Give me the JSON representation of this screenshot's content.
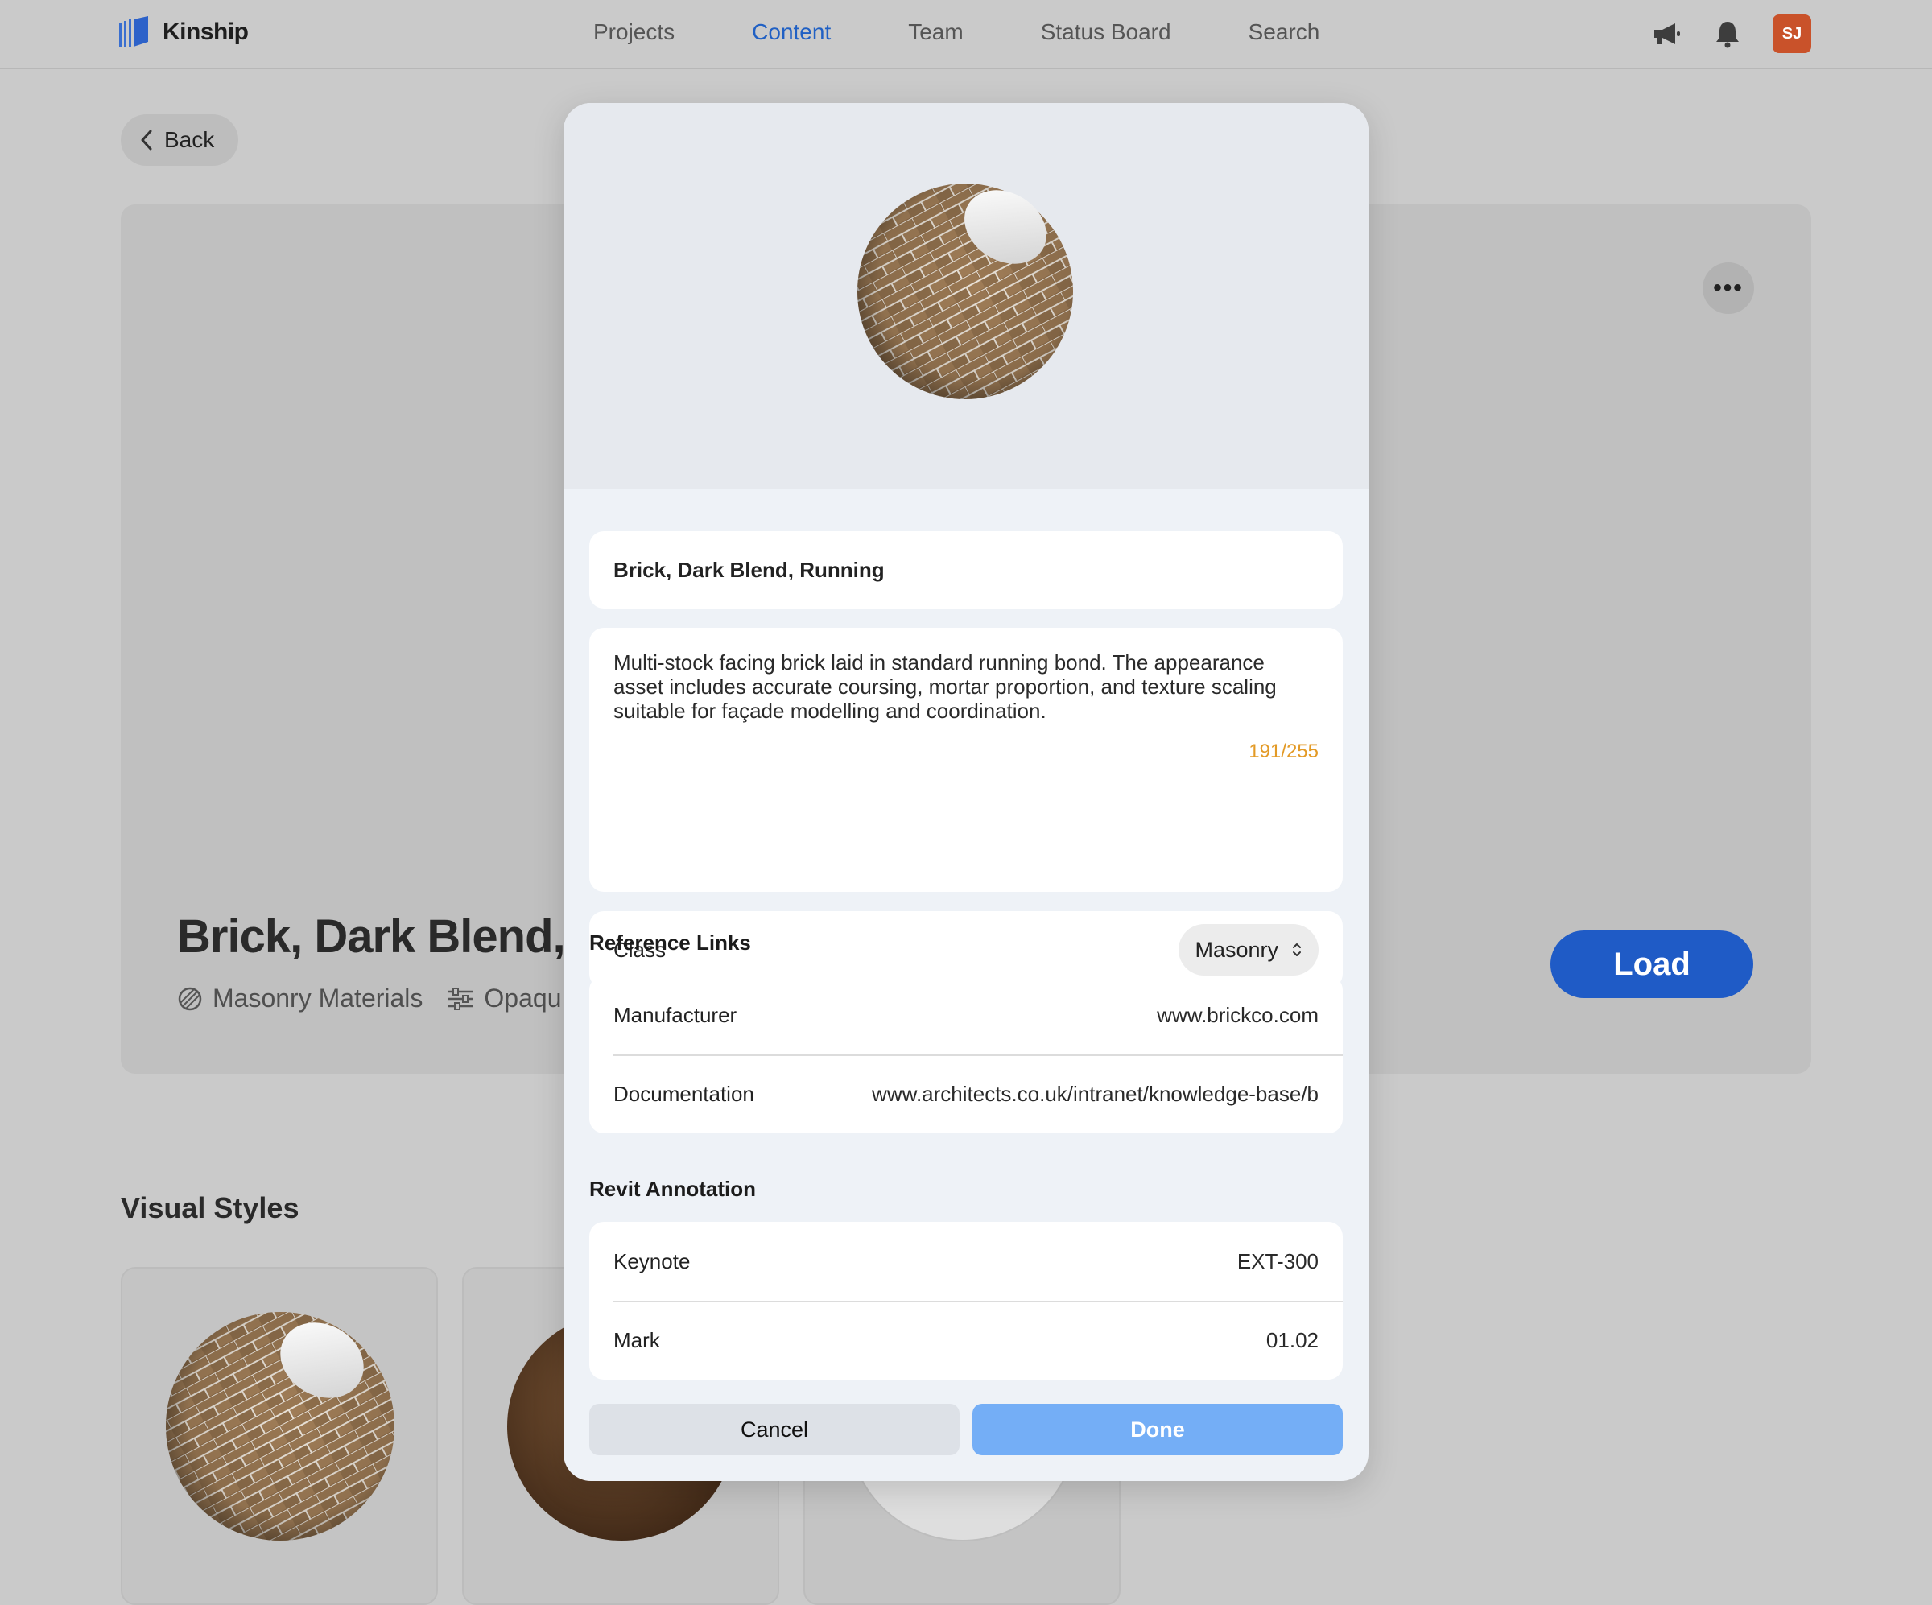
{
  "app": {
    "name": "Kinship",
    "nav": [
      {
        "label": "Projects",
        "active": false
      },
      {
        "label": "Content",
        "active": true
      },
      {
        "label": "Team",
        "active": false
      },
      {
        "label": "Status Board",
        "active": false
      },
      {
        "label": "Search",
        "active": false
      }
    ],
    "icons": [
      "megaphone-icon",
      "bell-icon"
    ],
    "avatar_initials": "SJ",
    "accent_color": "#2060c4",
    "avatar_color": "#c9522a"
  },
  "page": {
    "back_label": "Back",
    "title": "Brick, Dark Blend, R",
    "meta": [
      {
        "icon": "material-icon",
        "label": "Masonry Materials"
      },
      {
        "icon": "sliders-icon",
        "label": "Opaqu"
      }
    ],
    "more_label": "•••",
    "load_label": "Load",
    "load_color": "#1f5bc6",
    "section_title": "Visual Styles"
  },
  "modal": {
    "name": "Brick, Dark Blend, Running",
    "description": "Multi-stock facing brick laid in standard running bond. The appearance asset includes accurate coursing, mortar proportion, and texture scaling suitable for façade modelling and coordination.",
    "char_count": "191/255",
    "class_label": "Class",
    "class_value": "Masonry",
    "reference_links_title": "Reference Links",
    "reference_links": [
      {
        "label": "Manufacturer",
        "value": "www.brickco.com"
      },
      {
        "label": "Documentation",
        "value": "www.architects.co.uk/intranet/knowledge-base/b"
      }
    ],
    "revit_title": "Revit Annotation",
    "revit_rows": [
      {
        "label": "Keynote",
        "value": "EXT-300"
      },
      {
        "label": "Mark",
        "value": "01.02"
      }
    ],
    "cancel_label": "Cancel",
    "done_label": "Done",
    "done_color": "#74aef6"
  }
}
